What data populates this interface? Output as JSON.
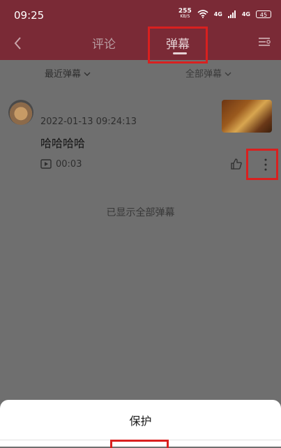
{
  "status": {
    "time": "09:25",
    "speed_value": "255",
    "speed_unit": "KB/S",
    "net1": "4G",
    "net2": "4G",
    "battery": "45"
  },
  "nav": {
    "tabs": [
      {
        "label": "评论"
      },
      {
        "label": "弹幕",
        "selected": true
      }
    ]
  },
  "filters": {
    "left": "最近弹幕",
    "right": "全部弹幕"
  },
  "danmu_item": {
    "timestamp": "2022-01-13 09:24:13",
    "message": "哈哈哈哈",
    "duration": "00:03"
  },
  "end_text": "已显示全部弹幕",
  "sheet": {
    "items": [
      {
        "label": "保护"
      }
    ]
  },
  "colors": {
    "header": "#7a2a36",
    "highlight": "#d9201f"
  },
  "icons": [
    "back-icon",
    "wifi-icon",
    "signal-icon",
    "battery-icon",
    "list-settings-icon",
    "chevron-down-icon",
    "play-icon",
    "thumbs-up-icon",
    "more-vertical-icon"
  ]
}
